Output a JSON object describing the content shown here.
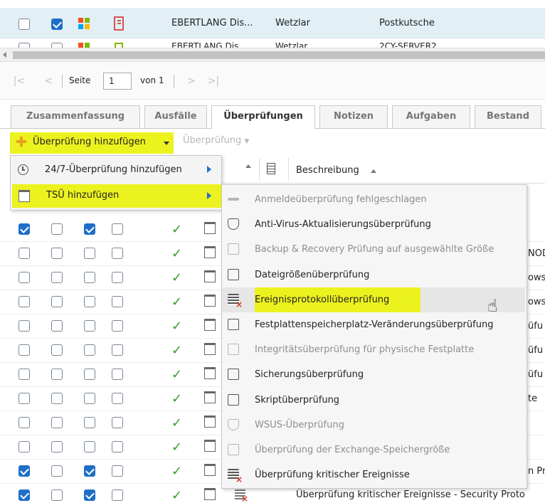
{
  "top_rows": [
    {
      "checked_left": false,
      "checked_right": true,
      "name": "EBERTLANG Dis...",
      "city": "Wetzlar",
      "server": "Postkutsche"
    },
    {
      "checked_left": false,
      "checked_right": false,
      "name": "EBERTLANG Dis...",
      "city": "Wetzlar",
      "server": "2CY-SERVER2"
    }
  ],
  "pager": {
    "page_label": "Seite",
    "page_value": "1",
    "of_label": "von 1"
  },
  "tabs": [
    "Zusammenfassung",
    "Ausfälle",
    "Überprüfungen",
    "Notizen",
    "Aufgaben",
    "Bestand"
  ],
  "toolbar": {
    "add_check": "Überprüfung hinzufügen",
    "check": "Überprüfung"
  },
  "grid": {
    "description_header": "Beschreibung"
  },
  "left_menu": [
    {
      "label": "24/7-Überprüfung hinzufügen"
    },
    {
      "label": "TSÜ hinzufügen"
    }
  ],
  "submenu": [
    {
      "label": "Anmeldeüberprüfung fehlgeschlagen",
      "disabled": true,
      "icon": "key-icon"
    },
    {
      "label": "Anti-Virus-Aktualisierungsüberprüfung",
      "disabled": false,
      "icon": "shield-icon"
    },
    {
      "label": "Backup & Recovery Prüfung auf ausgewählte Größe",
      "disabled": true,
      "icon": "backup-icon"
    },
    {
      "label": "Dateigrößenüberprüfung",
      "disabled": false,
      "icon": "disk-icon"
    },
    {
      "label": "Ereignisprotokollüberprüfung",
      "disabled": false,
      "icon": "event-log-icon",
      "highlighted": true
    },
    {
      "label": "Festplattenspeicherplatz-Veränderungsüberprüfung",
      "disabled": false,
      "icon": "disk-change-icon"
    },
    {
      "label": "Integritätsüberprüfung für physische Festplatte",
      "disabled": true,
      "icon": "disk-health-icon"
    },
    {
      "label": "Sicherungsüberprüfung",
      "disabled": false,
      "icon": "backup-icon"
    },
    {
      "label": "Skriptüberprüfung",
      "disabled": false,
      "icon": "script-icon"
    },
    {
      "label": "WSUS-Überprüfung",
      "disabled": true,
      "icon": "shield-icon"
    },
    {
      "label": "Überprüfung der Exchange-Speichergröße",
      "disabled": true,
      "icon": "mail-icon"
    },
    {
      "label": "Überprüfung kritischer Ereignisse",
      "disabled": false,
      "icon": "event-log-icon"
    }
  ],
  "bg_rows": [
    {
      "cbs": [
        true,
        false,
        true,
        false
      ],
      "right_text": ""
    },
    {
      "cbs": [
        false,
        false,
        false,
        false
      ],
      "right_text": "NOD"
    },
    {
      "cbs": [
        false,
        false,
        false,
        false
      ],
      "right_text": "ows"
    },
    {
      "cbs": [
        false,
        false,
        false,
        false
      ],
      "right_text": "ows"
    },
    {
      "cbs": [
        false,
        false,
        false,
        false
      ],
      "right_text": "üfu"
    },
    {
      "cbs": [
        false,
        false,
        false,
        false
      ],
      "right_text": "üfu"
    },
    {
      "cbs": [
        false,
        false,
        false,
        false
      ],
      "right_text": "üfu"
    },
    {
      "cbs": [
        false,
        false,
        false,
        false
      ],
      "right_text": "te"
    },
    {
      "cbs": [
        false,
        false,
        false,
        false
      ],
      "right_text": ""
    },
    {
      "cbs": [
        false,
        false,
        false,
        false
      ],
      "right_text": ""
    },
    {
      "cbs": [
        true,
        false,
        true,
        false
      ],
      "right_text": "n Pr"
    },
    {
      "cbs": [
        true,
        false,
        true,
        false
      ],
      "right_text": ""
    }
  ],
  "last_row_text": "Überprüfung kritischer Ereignisse - Security Proto",
  "colors": {
    "highlight": "#ecf21e",
    "accent": "#1e6fc8",
    "tick": "#3a9a2e"
  }
}
